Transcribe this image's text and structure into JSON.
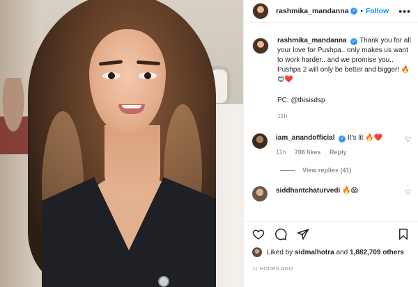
{
  "post": {
    "author": "rashmika_mandanna",
    "follow_label": "Follow",
    "separator": "•",
    "more_label": "•••",
    "caption_text": "Thank you for all your love for Pushpa.. only makes us want to work harder.. and we promise you.. Pushpa 2 will only be better and bigger! 🔥😊❤️",
    "caption_credit": "PC: @thisisdsp",
    "caption_time": "11h",
    "time_ago": "11 HOURS AGO"
  },
  "comments": [
    {
      "user": "iam_anandofficial",
      "text": "It's lit 🔥❤️",
      "time": "11h",
      "likes": "706 likes",
      "reply_label": "Reply",
      "view_replies": "View replies (41)"
    },
    {
      "user": "siddhantchaturvedi",
      "text": "🔥😱"
    }
  ],
  "likes": {
    "prefix": "Liked by",
    "user": "sidmalhotra",
    "conjunction": "and",
    "others": "1,882,709 others"
  },
  "icons": {
    "verified": "✓",
    "heart": "♡"
  },
  "colors": {
    "link": "#0095f6",
    "verified": "#3897f0",
    "muted": "#8e8e8e"
  }
}
